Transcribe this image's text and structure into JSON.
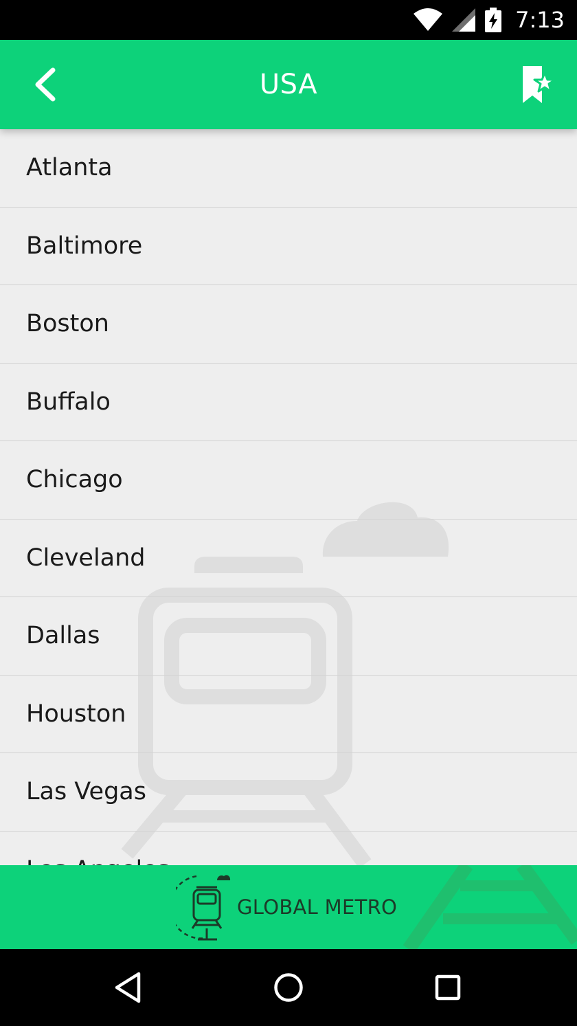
{
  "status_bar": {
    "time": "7:13",
    "icons": [
      "wifi-icon",
      "cell-signal-icon",
      "battery-charging-icon"
    ]
  },
  "header": {
    "title": "USA",
    "back_icon": "chevron-left-icon",
    "action_icon": "bookmark-star-icon"
  },
  "cities": [
    {
      "name": "Atlanta"
    },
    {
      "name": "Baltimore"
    },
    {
      "name": "Boston"
    },
    {
      "name": "Buffalo"
    },
    {
      "name": "Chicago"
    },
    {
      "name": "Cleveland"
    },
    {
      "name": "Dallas"
    },
    {
      "name": "Houston"
    },
    {
      "name": "Las Vegas"
    },
    {
      "name": "Los Angeles"
    }
  ],
  "banner": {
    "brand": "GLOBAL METRO",
    "logo_icon": "metro-train-logo-icon"
  },
  "nav_bar": {
    "icons": [
      "back-triangle-icon",
      "home-circle-icon",
      "recents-square-icon"
    ]
  },
  "colors": {
    "accent": "#0dd27a",
    "list_background": "#eeeeee",
    "divider": "#d2d2d2",
    "text": "#1a1a1a",
    "brand_text": "#1c3a28"
  }
}
